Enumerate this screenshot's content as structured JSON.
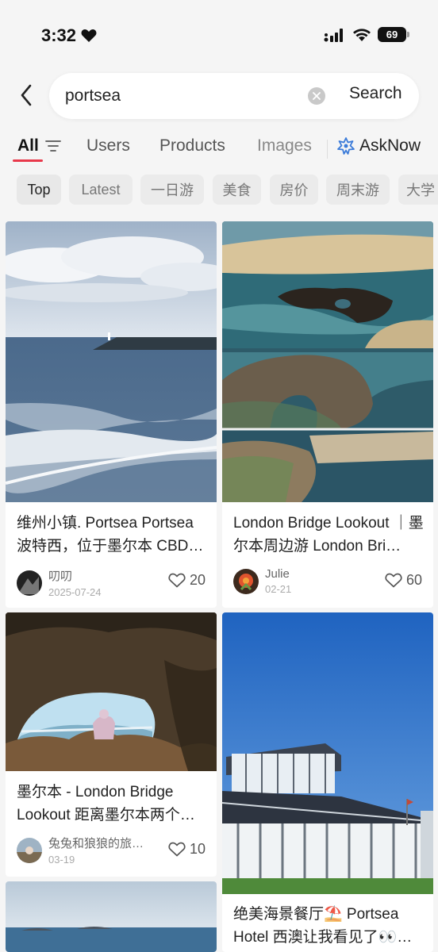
{
  "status": {
    "time": "3:32",
    "battery": "69"
  },
  "search": {
    "query": "portsea",
    "button_label": "Search"
  },
  "tabs": [
    {
      "label": "All"
    },
    {
      "label": "Users"
    },
    {
      "label": "Products"
    },
    {
      "label": "Images"
    }
  ],
  "asknow_label": "AskNow",
  "chips": [
    "Top",
    "Latest",
    "一日游",
    "美食",
    "房价",
    "周末游",
    "大学"
  ],
  "posts": [
    {
      "title": "维州小镇. Portsea Portsea 波特西，位于墨尔本 CBD…",
      "author": "叨叨",
      "date": "2025-07-24",
      "likes": "20"
    },
    {
      "title": "London Bridge Lookout ｜墨尔本周边游 London Bri…",
      "author": "Julie",
      "date": "02-21",
      "likes": "60"
    },
    {
      "title": "墨尔本 - London Bridge Lookout 距离墨尔本两个…",
      "author": "兔兔和狼狼的旅…",
      "date": "03-19",
      "likes": "10"
    },
    {
      "title": "绝美海景餐厅⛱️ Portsea Hotel 西澳让我看见了👀…",
      "author": "",
      "date": "",
      "likes": ""
    }
  ],
  "colors": {
    "accent": "#e8394b",
    "asknow_icon": "#3b7bd9"
  }
}
